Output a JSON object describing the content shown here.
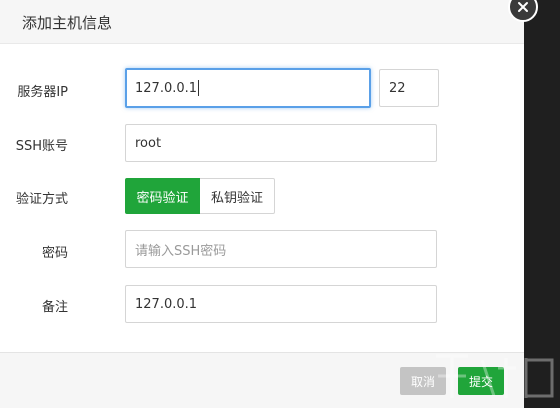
{
  "dialog": {
    "title": "添加主机信息"
  },
  "form": {
    "server_ip": {
      "label": "服务器IP",
      "value": "127.0.0.1",
      "port": "22"
    },
    "ssh_account": {
      "label": "SSH账号",
      "value": "root"
    },
    "auth": {
      "label": "验证方式",
      "options": [
        "密码验证",
        "私钥验证"
      ],
      "selected": "密码验证"
    },
    "password": {
      "label": "密码",
      "placeholder": "请输入SSH密码"
    },
    "remark": {
      "label": "备注",
      "value": "127.0.0.1"
    }
  },
  "footer": {
    "cancel_label": "取消",
    "submit_label": "提交"
  },
  "colors": {
    "accent_green": "#20a53a",
    "focus_blue": "#5aa0e8"
  },
  "icons": {
    "close": "close-icon"
  }
}
